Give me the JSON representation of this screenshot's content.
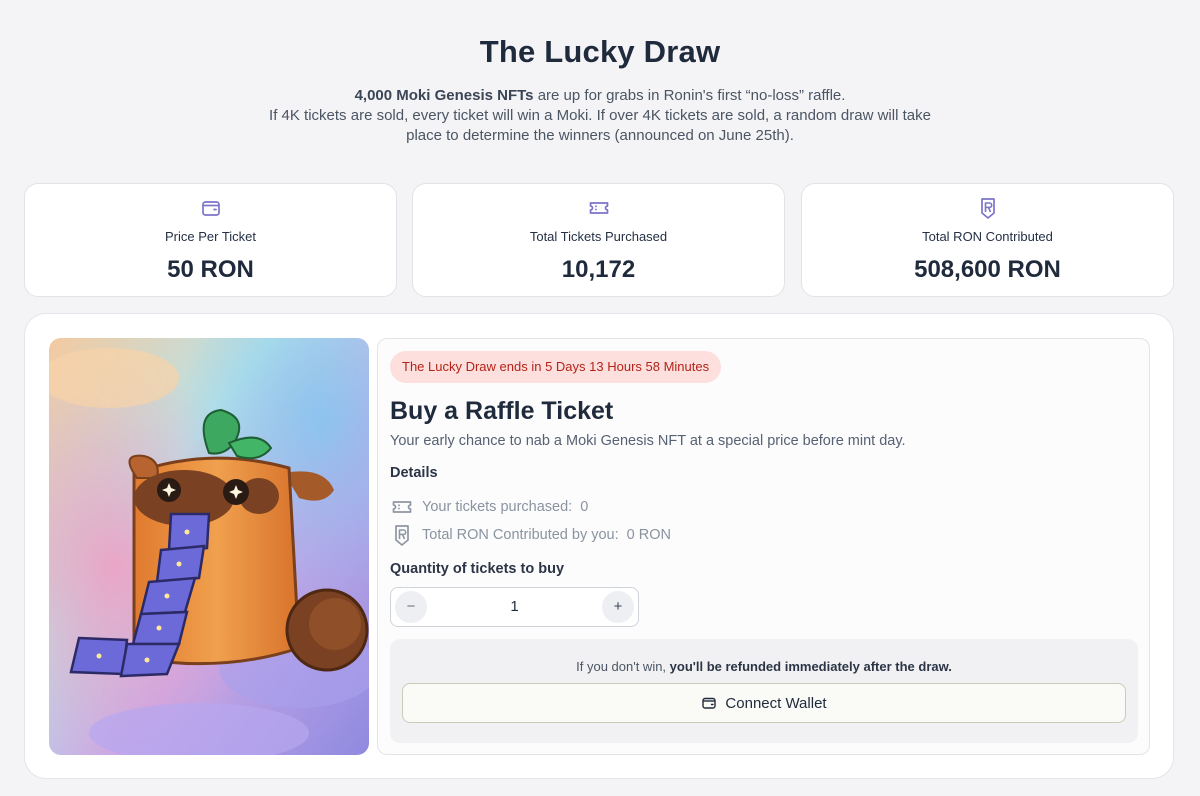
{
  "header": {
    "title": "The Lucky Draw",
    "intro_bold": "4,000 Moki Genesis NFTs",
    "intro_rest": " are up for grabs in Ronin's first “no-loss” raffle.",
    "line2": "If 4K tickets are sold, every ticket will win a Moki. If over 4K tickets are sold, a random draw will take",
    "line3": "place to determine the winners (announced on June 25th)."
  },
  "stats": [
    {
      "icon": "wallet-icon",
      "label": "Price Per Ticket",
      "value": "50 RON"
    },
    {
      "icon": "ticket-icon",
      "label": "Total Tickets Purchased",
      "value": "10,172"
    },
    {
      "icon": "ronin-shield-icon",
      "label": "Total RON Contributed",
      "value": "508,600 RON"
    }
  ],
  "raffle": {
    "countdown_prefix": "The Lucky Draw ends in",
    "countdown_time": "5 Days 13 Hours 58 Minutes",
    "title": "Buy a Raffle Ticket",
    "subtitle": "Your early chance to nab a Moki Genesis NFT at a special price before mint day.",
    "details_heading": "Details",
    "tickets_label": "Your tickets purchased:",
    "tickets_value": "0",
    "contrib_label": "Total RON Contributed by you:",
    "contrib_value": "0 RON",
    "quantity_heading": "Quantity of tickets to buy",
    "minus": "−",
    "quantity": "1",
    "plus": "+",
    "refund_prefix": "If you don't win, ",
    "refund_bold": "you'll be refunded immediately after the draw.",
    "connect_label": "Connect Wallet"
  },
  "colors": {
    "accent_icon": "#7b74c9",
    "countdown_bg": "#fde0de",
    "countdown_text": "#b42318",
    "background": "#f4f4f6"
  }
}
